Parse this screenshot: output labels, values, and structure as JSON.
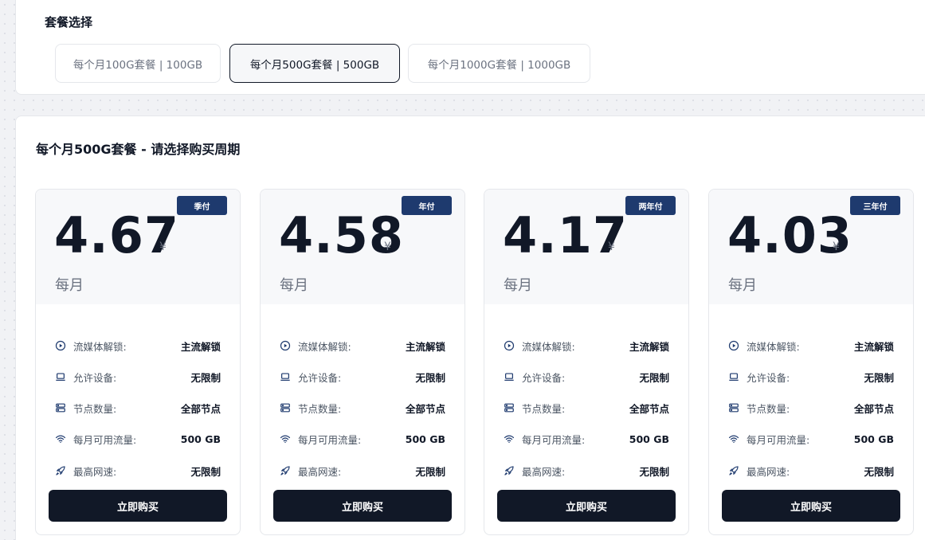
{
  "plans": {
    "title": "套餐选择",
    "tabs": [
      {
        "label": "每个月100G套餐 | 100GB",
        "active": false
      },
      {
        "label": "每个月500G套餐 | 500GB",
        "active": true
      },
      {
        "label": "每个月1000G套餐 | 1000GB",
        "active": false
      }
    ]
  },
  "cycle": {
    "title": "每个月500G套餐 - 请选择购买周期",
    "cards": [
      {
        "badge": "季付",
        "price": "4.67",
        "currency": "¥",
        "period": "每月",
        "features": [
          {
            "icon": "play-circle-icon",
            "label": "流媒体解锁:",
            "value": "主流解锁"
          },
          {
            "icon": "laptop-icon",
            "label": "允许设备:",
            "value": "无限制"
          },
          {
            "icon": "server-icon",
            "label": "节点数量:",
            "value": "全部节点"
          },
          {
            "icon": "wifi-icon",
            "label": "每月可用流量:",
            "value": "500 GB"
          },
          {
            "icon": "rocket-icon",
            "label": "最高网速:",
            "value": "无限制"
          }
        ],
        "button": "立即购买"
      },
      {
        "badge": "年付",
        "price": "4.58",
        "currency": "¥",
        "period": "每月",
        "features": [
          {
            "icon": "play-circle-icon",
            "label": "流媒体解锁:",
            "value": "主流解锁"
          },
          {
            "icon": "laptop-icon",
            "label": "允许设备:",
            "value": "无限制"
          },
          {
            "icon": "server-icon",
            "label": "节点数量:",
            "value": "全部节点"
          },
          {
            "icon": "wifi-icon",
            "label": "每月可用流量:",
            "value": "500 GB"
          },
          {
            "icon": "rocket-icon",
            "label": "最高网速:",
            "value": "无限制"
          }
        ],
        "button": "立即购买"
      },
      {
        "badge": "两年付",
        "price": "4.17",
        "currency": "¥",
        "period": "每月",
        "features": [
          {
            "icon": "play-circle-icon",
            "label": "流媒体解锁:",
            "value": "主流解锁"
          },
          {
            "icon": "laptop-icon",
            "label": "允许设备:",
            "value": "无限制"
          },
          {
            "icon": "server-icon",
            "label": "节点数量:",
            "value": "全部节点"
          },
          {
            "icon": "wifi-icon",
            "label": "每月可用流量:",
            "value": "500 GB"
          },
          {
            "icon": "rocket-icon",
            "label": "最高网速:",
            "value": "无限制"
          }
        ],
        "button": "立即购买"
      },
      {
        "badge": "三年付",
        "price": "4.03",
        "currency": "¥",
        "period": "每月",
        "features": [
          {
            "icon": "play-circle-icon",
            "label": "流媒体解锁:",
            "value": "主流解锁"
          },
          {
            "icon": "laptop-icon",
            "label": "允许设备:",
            "value": "无限制"
          },
          {
            "icon": "server-icon",
            "label": "节点数量:",
            "value": "全部节点"
          },
          {
            "icon": "wifi-icon",
            "label": "每月可用流量:",
            "value": "500 GB"
          },
          {
            "icon": "rocket-icon",
            "label": "最高网速:",
            "value": "无限制"
          }
        ],
        "button": "立即购买"
      }
    ]
  },
  "colors": {
    "badge_bg": "#1e3a6e",
    "button_bg": "#111827",
    "icon_color": "#1e3a6e"
  }
}
